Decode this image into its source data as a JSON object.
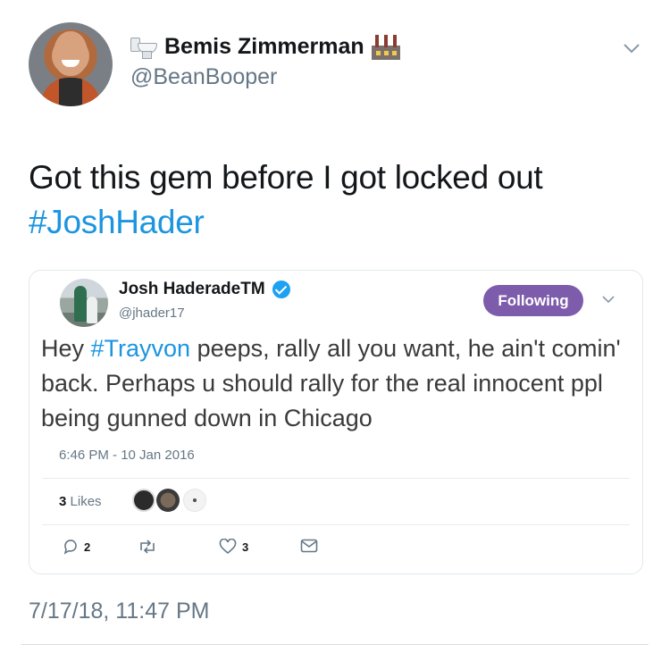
{
  "tweet": {
    "display_name": "Bemis Zimmerman",
    "handle": "@BeanBooper",
    "text": "Got this gem before I got locked out",
    "hashtag": "#JoshHader",
    "timestamp": "7/17/18, 11:47 PM"
  },
  "embedded": {
    "display_name": "Josh HaderadeTM",
    "handle": "@jhader17",
    "follow_label": "Following",
    "text_before": "Hey ",
    "hashtag": "#Trayvon",
    "text_after": " peeps, rally all you want, he ain't comin' back.  Perhaps u should rally for the real innocent ppl being gunned down in Chicago",
    "time": "6:46 PM - 10 Jan 2016",
    "likes_count": "3",
    "likes_label": "Likes",
    "reply_count": "2",
    "like_count": "3"
  },
  "colors": {
    "link": "#1b95e0",
    "follow_button": "#7d5cab",
    "muted": "#657786"
  }
}
